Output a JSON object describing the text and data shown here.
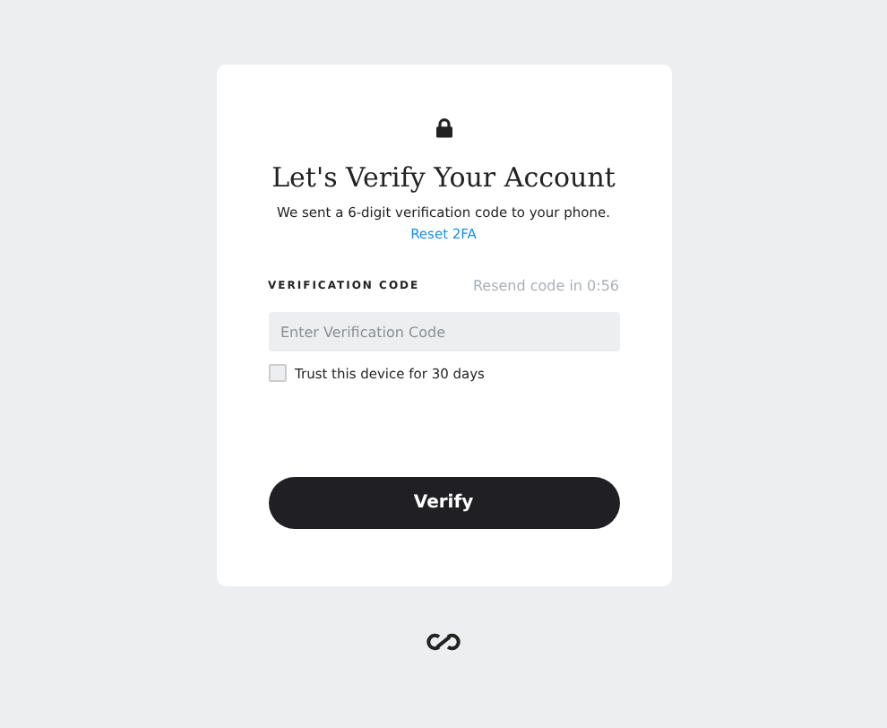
{
  "title": "Let's Verify Your Account",
  "message": "We sent a 6-digit verification code to your phone.",
  "reset_link": "Reset 2FA",
  "code_label": "VERIFICATION CODE",
  "resend": "Resend code in 0:56",
  "code_field": {
    "placeholder": "Enter Verification Code"
  },
  "trust_device": {
    "label": "Trust this device for 30 days",
    "checked": false
  },
  "verify_button": "Verify"
}
